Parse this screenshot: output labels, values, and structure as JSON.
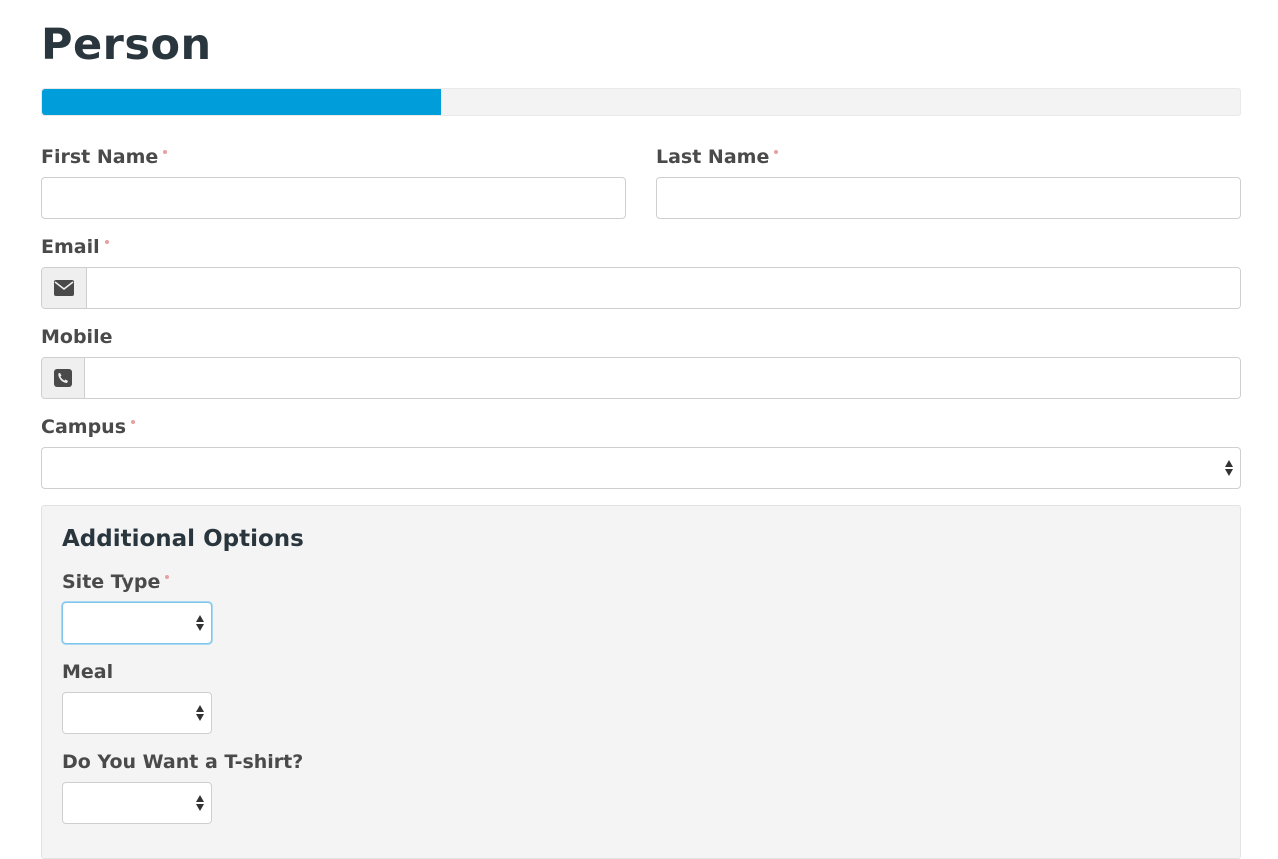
{
  "page": {
    "title": "Person"
  },
  "progress": {
    "percent": 33.3
  },
  "form": {
    "first_name": {
      "label": "First Name",
      "value": ""
    },
    "last_name": {
      "label": "Last Name",
      "value": ""
    },
    "email": {
      "label": "Email",
      "value": ""
    },
    "mobile": {
      "label": "Mobile",
      "value": ""
    },
    "campus": {
      "label": "Campus",
      "selected": ""
    }
  },
  "additional_options": {
    "title": "Additional Options",
    "site_type": {
      "label": "Site Type",
      "selected": ""
    },
    "meal": {
      "label": "Meal",
      "selected": ""
    },
    "tshirt": {
      "label": "Do You Want a T-shirt?",
      "selected": ""
    }
  },
  "icons": {
    "email": "envelope-icon",
    "mobile": "phone-icon"
  },
  "colors": {
    "accent": "#009ddb",
    "required": "#e8a0a0",
    "focus": "#7fc4ea"
  }
}
